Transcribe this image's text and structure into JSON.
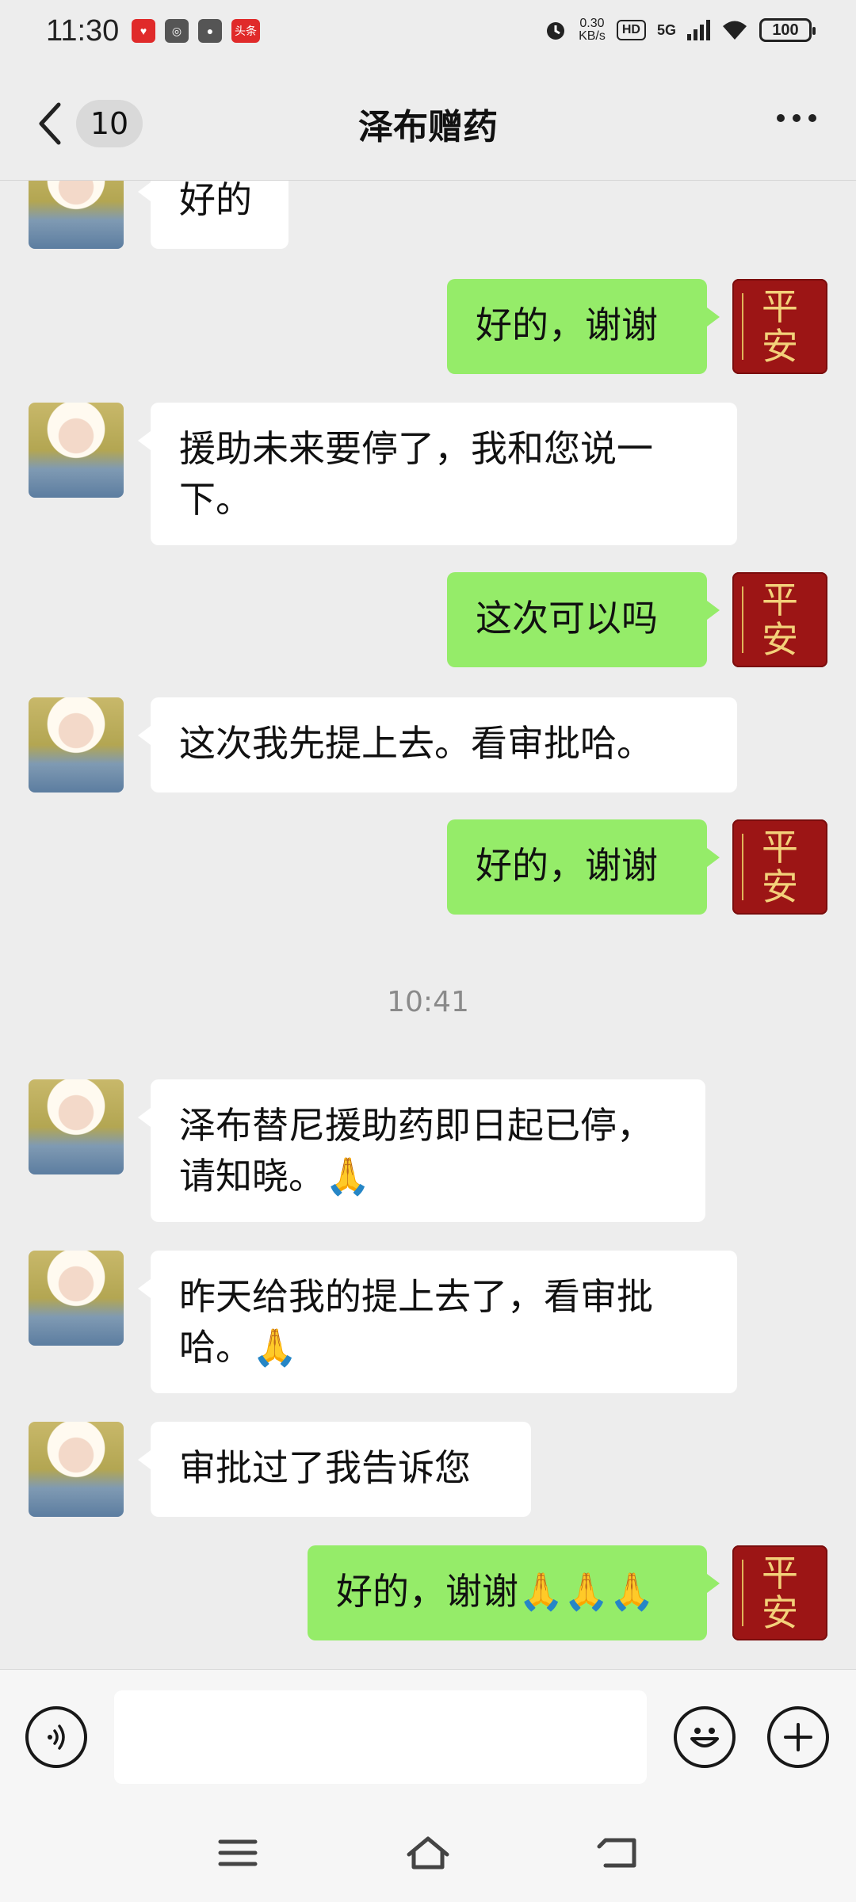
{
  "status_bar": {
    "time": "11:30",
    "app_icons": [
      "mail-heart-icon",
      "planet-icon",
      "map-pin-icon",
      "toutiao-icon"
    ],
    "toutiao_label": "头条",
    "net_speed_value": "0.30",
    "net_speed_unit": "KB/s",
    "hd": "HD",
    "network": "5G",
    "battery": "100"
  },
  "header": {
    "unread_count": "10",
    "title": "泽布赠药"
  },
  "messages": [
    {
      "side": "in",
      "text": "好的"
    },
    {
      "side": "out",
      "text": "好的，谢谢"
    },
    {
      "side": "in",
      "text": "援助未来要停了，我和您说一\n下。"
    },
    {
      "side": "out",
      "text": "这次可以吗"
    },
    {
      "side": "in",
      "text": "这次我先提上去。看审批哈。"
    },
    {
      "side": "out",
      "text": "好的，谢谢"
    },
    {
      "side": "time",
      "text": "10:41"
    },
    {
      "side": "in",
      "text": "泽布替尼援助药即日起已停，\n请知晓。🙏"
    },
    {
      "side": "in",
      "text": "昨天给我的提上去了，看审批\n哈。🙏"
    },
    {
      "side": "in",
      "text": "审批过了我告诉您"
    },
    {
      "side": "out",
      "text": "好的，谢谢🙏🙏🙏"
    }
  ],
  "self_avatar": {
    "line1": "平",
    "line2": "安"
  },
  "input": {
    "value": "",
    "placeholder": ""
  },
  "icons": {
    "voice": "voice-icon",
    "emoji": "emoji-icon",
    "plus": "plus-icon",
    "nav_menu": "menu-icon",
    "nav_home": "home-icon",
    "nav_back": "back-icon"
  }
}
